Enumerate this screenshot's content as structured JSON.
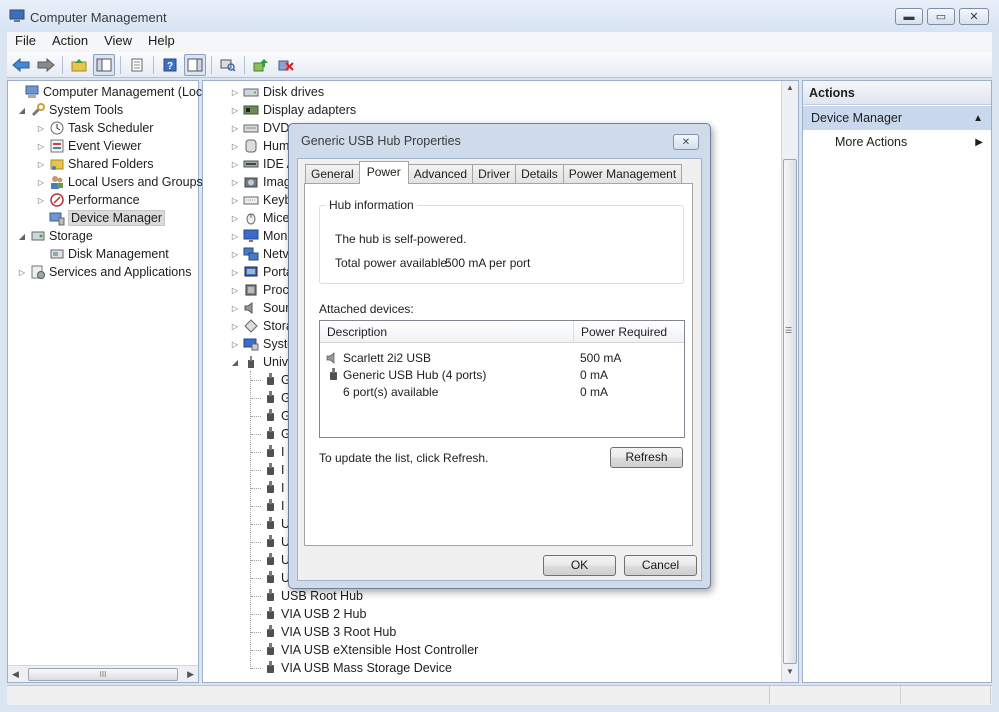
{
  "window": {
    "title": "Computer Management",
    "min_glyph": "▬",
    "max_glyph": "▭",
    "close_glyph": "✕"
  },
  "menu": [
    "File",
    "Action",
    "View",
    "Help"
  ],
  "tree": {
    "items": [
      {
        "label": "Computer Management (Local",
        "icon": "computer-icon",
        "expander": ""
      },
      {
        "label": "System Tools",
        "icon": "tools-icon",
        "expander": "◢"
      },
      {
        "label": "Task Scheduler",
        "icon": "clock-icon",
        "expander": "▷"
      },
      {
        "label": "Event Viewer",
        "icon": "event-viewer-icon",
        "expander": "▷"
      },
      {
        "label": "Shared Folders",
        "icon": "shared-folder-icon",
        "expander": "▷"
      },
      {
        "label": "Local Users and Groups",
        "icon": "users-icon",
        "expander": "▷"
      },
      {
        "label": "Performance",
        "icon": "performance-icon",
        "expander": "▷"
      },
      {
        "label": "Device Manager",
        "icon": "device-manager-icon",
        "expander": ""
      },
      {
        "label": "Storage",
        "icon": "storage-icon",
        "expander": "◢"
      },
      {
        "label": "Disk Management",
        "icon": "disk-icon",
        "expander": ""
      },
      {
        "label": "Services and Applications",
        "icon": "services-icon",
        "expander": "▷"
      }
    ],
    "scroll_grip": "III"
  },
  "devices": {
    "categories": [
      {
        "label": "Disk drives",
        "icon": "disk-drive-icon"
      },
      {
        "label": "Display adapters",
        "icon": "display-adapter-icon"
      },
      {
        "label": "DVD",
        "icon": "dvd-icon"
      },
      {
        "label": "Hum",
        "icon": "hid-icon"
      },
      {
        "label": "IDE A",
        "icon": "ide-icon"
      },
      {
        "label": "Imag",
        "icon": "imaging-icon"
      },
      {
        "label": "Keyb",
        "icon": "keyboard-icon"
      },
      {
        "label": "Mice",
        "icon": "mouse-icon"
      },
      {
        "label": "Mon",
        "icon": "monitor-icon"
      },
      {
        "label": "Netv",
        "icon": "network-icon"
      },
      {
        "label": "Porta",
        "icon": "portable-icon"
      },
      {
        "label": "Proc",
        "icon": "processor-icon"
      },
      {
        "label": "Sour",
        "icon": "sound-icon"
      },
      {
        "label": "Stora",
        "icon": "storage-controller-icon"
      },
      {
        "label": "Syste",
        "icon": "system-icon"
      },
      {
        "label": "Univ",
        "icon": "usb-icon"
      }
    ],
    "usb_children": [
      "G",
      "G",
      "G",
      "G",
      "I",
      "I",
      "I",
      "I",
      "U",
      "U",
      "U",
      "U",
      "USB Root Hub",
      "VIA USB 2 Hub",
      "VIA USB 3 Root Hub",
      "VIA USB eXtensible Host Controller",
      "VIA USB Mass Storage Device"
    ]
  },
  "actions": {
    "header": "Actions",
    "section": "Device Manager",
    "more": "More Actions"
  },
  "dialog": {
    "title": "Generic USB Hub Properties",
    "tabs": [
      "General",
      "Power",
      "Advanced",
      "Driver",
      "Details",
      "Power Management"
    ],
    "active_tab": "Power",
    "hub_group_title": "Hub information",
    "self_powered": "The hub is self-powered.",
    "total_power_label": "Total power available:",
    "total_power_value": "500 mA per port",
    "attached_label": "Attached devices:",
    "columns": [
      "Description",
      "Power Required"
    ],
    "rows": [
      {
        "description": "Scarlett 2i2 USB",
        "power": "500 mA",
        "icon": "speaker-icon"
      },
      {
        "description": "Generic USB Hub (4 ports)",
        "power": "0 mA",
        "icon": "usb-icon"
      },
      {
        "description": "6 port(s) available",
        "power": "0 mA",
        "icon": ""
      }
    ],
    "update_text": "To update the list, click Refresh.",
    "refresh": "Refresh",
    "ok": "OK",
    "cancel": "Cancel"
  }
}
